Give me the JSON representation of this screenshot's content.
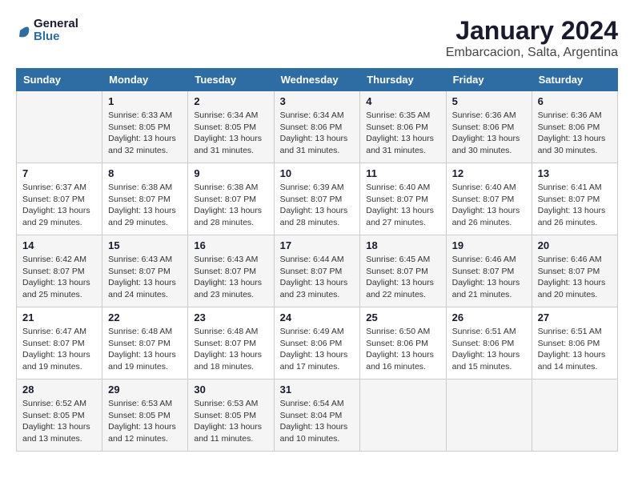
{
  "logo": {
    "text_general": "General",
    "text_blue": "Blue"
  },
  "title": "January 2024",
  "location": "Embarcacion, Salta, Argentina",
  "days_header": [
    "Sunday",
    "Monday",
    "Tuesday",
    "Wednesday",
    "Thursday",
    "Friday",
    "Saturday"
  ],
  "weeks": [
    [
      {
        "day": "",
        "info": ""
      },
      {
        "day": "1",
        "info": "Sunrise: 6:33 AM\nSunset: 8:05 PM\nDaylight: 13 hours\nand 32 minutes."
      },
      {
        "day": "2",
        "info": "Sunrise: 6:34 AM\nSunset: 8:05 PM\nDaylight: 13 hours\nand 31 minutes."
      },
      {
        "day": "3",
        "info": "Sunrise: 6:34 AM\nSunset: 8:06 PM\nDaylight: 13 hours\nand 31 minutes."
      },
      {
        "day": "4",
        "info": "Sunrise: 6:35 AM\nSunset: 8:06 PM\nDaylight: 13 hours\nand 31 minutes."
      },
      {
        "day": "5",
        "info": "Sunrise: 6:36 AM\nSunset: 8:06 PM\nDaylight: 13 hours\nand 30 minutes."
      },
      {
        "day": "6",
        "info": "Sunrise: 6:36 AM\nSunset: 8:06 PM\nDaylight: 13 hours\nand 30 minutes."
      }
    ],
    [
      {
        "day": "7",
        "info": "Sunrise: 6:37 AM\nSunset: 8:07 PM\nDaylight: 13 hours\nand 29 minutes."
      },
      {
        "day": "8",
        "info": "Sunrise: 6:38 AM\nSunset: 8:07 PM\nDaylight: 13 hours\nand 29 minutes."
      },
      {
        "day": "9",
        "info": "Sunrise: 6:38 AM\nSunset: 8:07 PM\nDaylight: 13 hours\nand 28 minutes."
      },
      {
        "day": "10",
        "info": "Sunrise: 6:39 AM\nSunset: 8:07 PM\nDaylight: 13 hours\nand 28 minutes."
      },
      {
        "day": "11",
        "info": "Sunrise: 6:40 AM\nSunset: 8:07 PM\nDaylight: 13 hours\nand 27 minutes."
      },
      {
        "day": "12",
        "info": "Sunrise: 6:40 AM\nSunset: 8:07 PM\nDaylight: 13 hours\nand 26 minutes."
      },
      {
        "day": "13",
        "info": "Sunrise: 6:41 AM\nSunset: 8:07 PM\nDaylight: 13 hours\nand 26 minutes."
      }
    ],
    [
      {
        "day": "14",
        "info": "Sunrise: 6:42 AM\nSunset: 8:07 PM\nDaylight: 13 hours\nand 25 minutes."
      },
      {
        "day": "15",
        "info": "Sunrise: 6:43 AM\nSunset: 8:07 PM\nDaylight: 13 hours\nand 24 minutes."
      },
      {
        "day": "16",
        "info": "Sunrise: 6:43 AM\nSunset: 8:07 PM\nDaylight: 13 hours\nand 23 minutes."
      },
      {
        "day": "17",
        "info": "Sunrise: 6:44 AM\nSunset: 8:07 PM\nDaylight: 13 hours\nand 23 minutes."
      },
      {
        "day": "18",
        "info": "Sunrise: 6:45 AM\nSunset: 8:07 PM\nDaylight: 13 hours\nand 22 minutes."
      },
      {
        "day": "19",
        "info": "Sunrise: 6:46 AM\nSunset: 8:07 PM\nDaylight: 13 hours\nand 21 minutes."
      },
      {
        "day": "20",
        "info": "Sunrise: 6:46 AM\nSunset: 8:07 PM\nDaylight: 13 hours\nand 20 minutes."
      }
    ],
    [
      {
        "day": "21",
        "info": "Sunrise: 6:47 AM\nSunset: 8:07 PM\nDaylight: 13 hours\nand 19 minutes."
      },
      {
        "day": "22",
        "info": "Sunrise: 6:48 AM\nSunset: 8:07 PM\nDaylight: 13 hours\nand 19 minutes."
      },
      {
        "day": "23",
        "info": "Sunrise: 6:48 AM\nSunset: 8:07 PM\nDaylight: 13 hours\nand 18 minutes."
      },
      {
        "day": "24",
        "info": "Sunrise: 6:49 AM\nSunset: 8:06 PM\nDaylight: 13 hours\nand 17 minutes."
      },
      {
        "day": "25",
        "info": "Sunrise: 6:50 AM\nSunset: 8:06 PM\nDaylight: 13 hours\nand 16 minutes."
      },
      {
        "day": "26",
        "info": "Sunrise: 6:51 AM\nSunset: 8:06 PM\nDaylight: 13 hours\nand 15 minutes."
      },
      {
        "day": "27",
        "info": "Sunrise: 6:51 AM\nSunset: 8:06 PM\nDaylight: 13 hours\nand 14 minutes."
      }
    ],
    [
      {
        "day": "28",
        "info": "Sunrise: 6:52 AM\nSunset: 8:05 PM\nDaylight: 13 hours\nand 13 minutes."
      },
      {
        "day": "29",
        "info": "Sunrise: 6:53 AM\nSunset: 8:05 PM\nDaylight: 13 hours\nand 12 minutes."
      },
      {
        "day": "30",
        "info": "Sunrise: 6:53 AM\nSunset: 8:05 PM\nDaylight: 13 hours\nand 11 minutes."
      },
      {
        "day": "31",
        "info": "Sunrise: 6:54 AM\nSunset: 8:04 PM\nDaylight: 13 hours\nand 10 minutes."
      },
      {
        "day": "",
        "info": ""
      },
      {
        "day": "",
        "info": ""
      },
      {
        "day": "",
        "info": ""
      }
    ]
  ]
}
